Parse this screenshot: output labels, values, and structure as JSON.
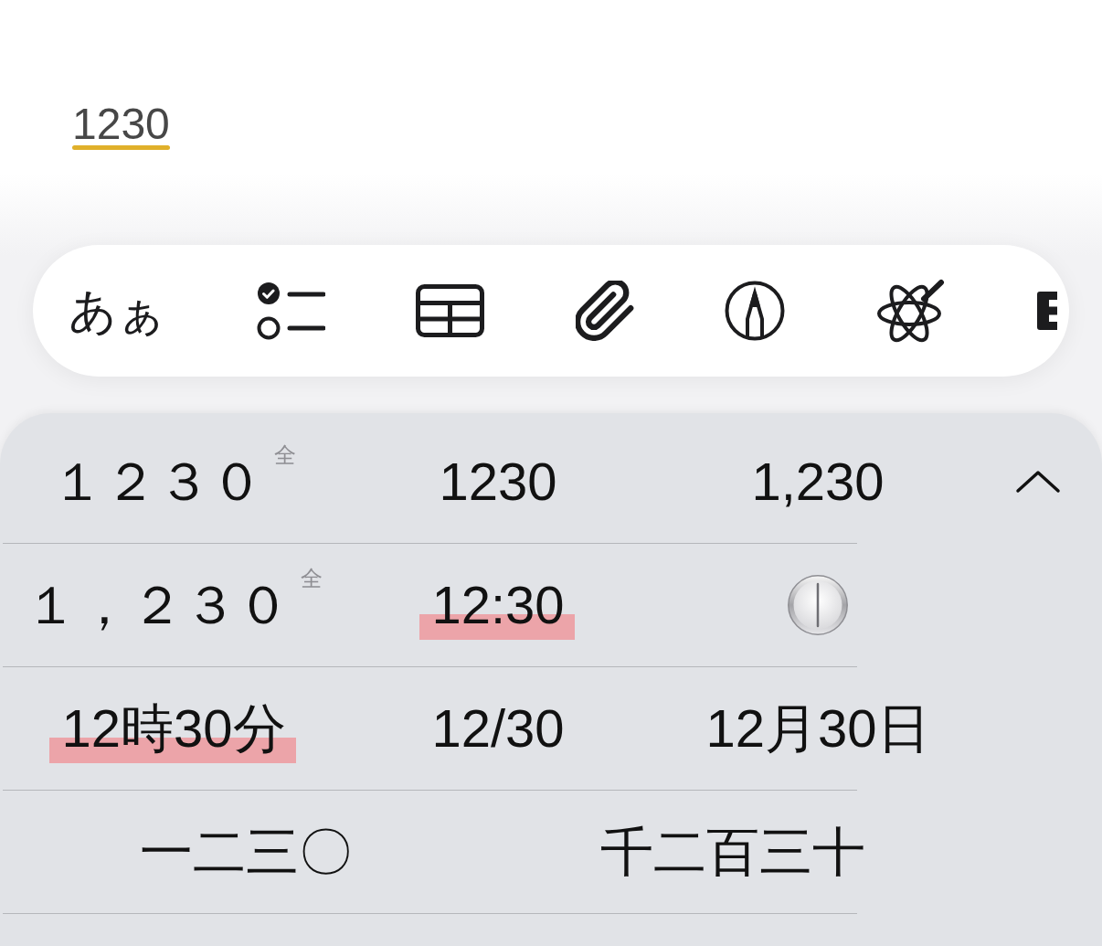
{
  "note": {
    "composing_text": "1230",
    "composing": true
  },
  "toolbar": {
    "items": [
      {
        "kind": "text",
        "label": "あぁ"
      },
      {
        "kind": "checklist"
      },
      {
        "kind": "table"
      },
      {
        "kind": "attachment"
      },
      {
        "kind": "markup"
      },
      {
        "kind": "writing"
      },
      {
        "kind": "clipped"
      }
    ]
  },
  "candidates": {
    "expanded": true,
    "rows": [
      {
        "items": [
          {
            "kind": "text",
            "text": "１２３０",
            "badge": "全",
            "highlighted": false
          },
          {
            "kind": "text",
            "text": "1230",
            "highlighted": false
          },
          {
            "kind": "text",
            "text": "1,230",
            "highlighted": false
          }
        ]
      },
      {
        "items": [
          {
            "kind": "text",
            "text": "１，２３０",
            "badge": "全",
            "highlighted": false
          },
          {
            "kind": "text",
            "text": "12:30",
            "highlighted": true
          },
          {
            "kind": "emoji",
            "highlighted": false
          }
        ]
      },
      {
        "items": [
          {
            "kind": "text",
            "text": "12時30分",
            "highlighted": true
          },
          {
            "kind": "text",
            "text": "12/30",
            "highlighted": false
          },
          {
            "kind": "text",
            "text": "12月30日",
            "highlighted": false
          }
        ]
      },
      {
        "items": [
          {
            "kind": "text",
            "text": "一二三〇",
            "highlighted": false
          },
          {
            "kind": "text",
            "text": "千二百三十",
            "highlighted": false
          }
        ]
      }
    ]
  }
}
